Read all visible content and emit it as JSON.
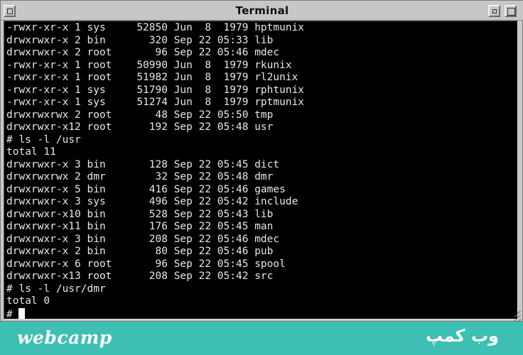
{
  "window": {
    "title": "Terminal"
  },
  "terminal": {
    "lines": [
      "-rwxr-xr-x 1 sys     52850 Jun  8  1979 hptmunix",
      "drwxrwxr-x 2 bin       320 Sep 22 05:33 lib",
      "drwxrwxr-x 2 root       96 Sep 22 05:46 mdec",
      "-rwxr-xr-x 1 root    50990 Jun  8  1979 rkunix",
      "-rwxr-xr-x 1 root    51982 Jun  8  1979 rl2unix",
      "-rwxr-xr-x 1 sys     51790 Jun  8  1979 rphtunix",
      "-rwxr-xr-x 1 sys     51274 Jun  8  1979 rptmunix",
      "drwxrwxrwx 2 root       48 Sep 22 05:50 tmp",
      "drwxrwxr-x12 root      192 Sep 22 05:48 usr",
      "# ls -l /usr",
      "total 11",
      "drwxrwxr-x 3 bin       128 Sep 22 05:45 dict",
      "drwxrwxrwx 2 dmr        32 Sep 22 05:48 dmr",
      "drwxrwxr-x 5 bin       416 Sep 22 05:46 games",
      "drwxrwxr-x 3 sys       496 Sep 22 05:42 include",
      "drwxrwxr-x10 bin       528 Sep 22 05:43 lib",
      "drwxrwxr-x11 bin       176 Sep 22 05:45 man",
      "drwxrwxr-x 3 bin       208 Sep 22 05:46 mdec",
      "drwxrwxr-x 2 bin        80 Sep 22 05:46 pub",
      "drwxrwxr-x 6 root       96 Sep 22 05:45 spool",
      "drwxrwxr-x13 root      208 Sep 22 05:42 src",
      "# ls -l /usr/dmr",
      "total 0"
    ],
    "prompt": "# "
  },
  "banner": {
    "logo_latin": "webcamp",
    "logo_persian": "وب کمپ"
  },
  "colors": {
    "terminal_bg": "#000000",
    "terminal_fg": "#e8e8e8",
    "titlebar_bg": "#c7c7c7",
    "banner_bg": "#3dbfb3"
  },
  "icons": {
    "close": "window-menu-icon",
    "minimize": "minimize-icon",
    "maximize": "maximize-icon",
    "resize": "resize-grip-icon"
  }
}
